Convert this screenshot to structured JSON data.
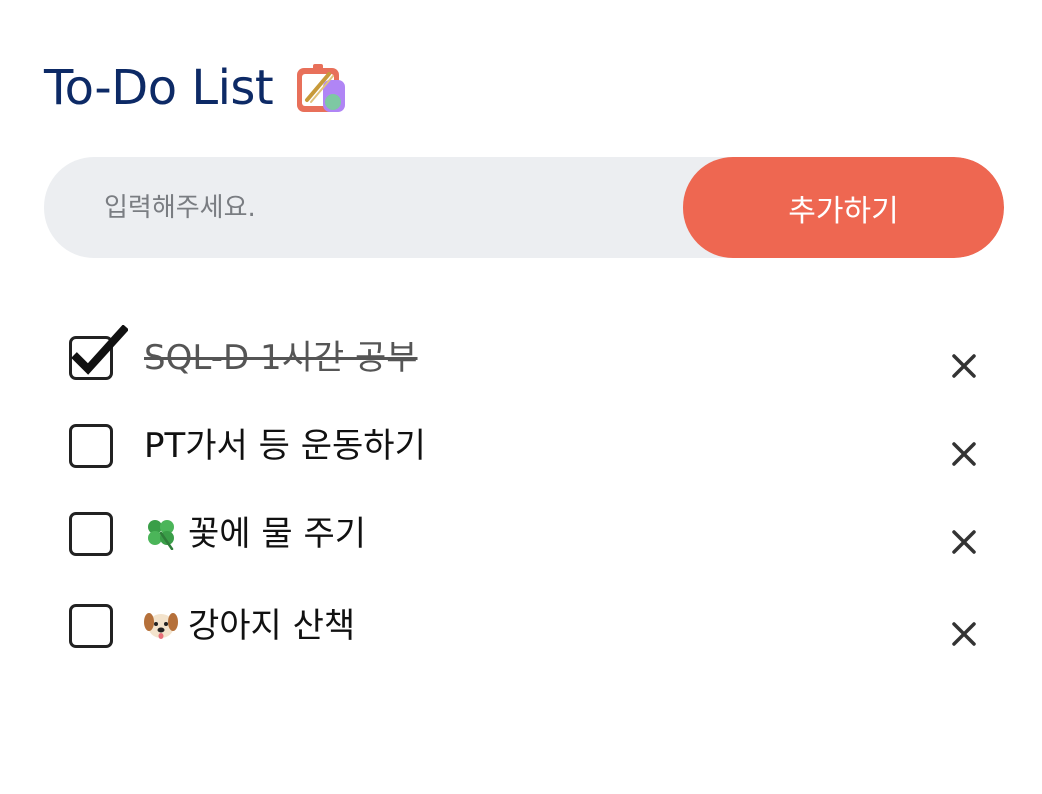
{
  "header": {
    "title": "To-Do List",
    "icon": "memo-pencil-icon"
  },
  "input": {
    "placeholder": "입력해주세요.",
    "value": ""
  },
  "add_button": {
    "label": "추가하기"
  },
  "colors": {
    "title": "#0d2a66",
    "accent": "#ee6751",
    "input_bg": "#eceef1"
  },
  "todos": [
    {
      "text": "SQL-D 1시간 공부",
      "done": true,
      "emoji": null
    },
    {
      "text": "PT가서 등 운동하기",
      "done": false,
      "emoji": null
    },
    {
      "text": "꽃에 물 주기",
      "done": false,
      "emoji": "four-leaf-clover-icon"
    },
    {
      "text": "강아지 산책",
      "done": false,
      "emoji": "dog-face-icon"
    }
  ]
}
